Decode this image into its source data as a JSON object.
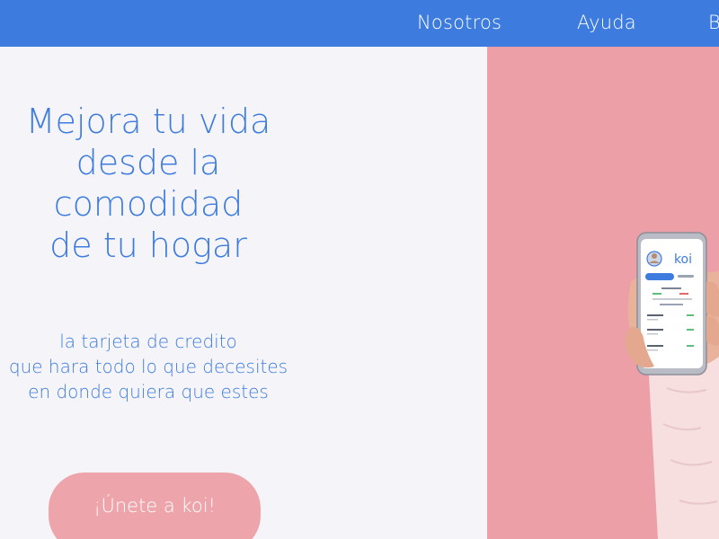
{
  "nav": {
    "items": [
      "Nosotros",
      "Ayuda",
      "B"
    ]
  },
  "hero": {
    "title_lines": [
      "Mejora tu vida",
      "desde la",
      "comodidad",
      "de tu hogar"
    ],
    "subtitle_lines": [
      "la tarjeta de credito",
      "que hara todo lo que decesites",
      "en donde quiera que estes"
    ],
    "cta_label": "¡Únete a koi!"
  },
  "phone": {
    "app_name": "koi"
  },
  "colors": {
    "brand_blue": "#3d7cde",
    "pink_panel": "#ec9fa7",
    "cta_pink": "#eda5ab",
    "background": "#f5f4f8"
  }
}
